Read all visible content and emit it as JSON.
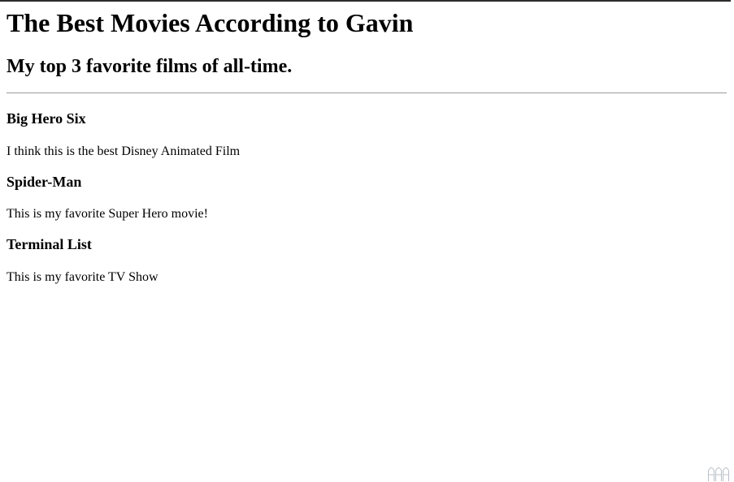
{
  "page": {
    "heading": "The Best Movies According to Gavin",
    "subheading": "My top 3 favorite films of all-time."
  },
  "movies": [
    {
      "title": "Big Hero Six",
      "description": "I think this is the best Disney Animated Film"
    },
    {
      "title": "Spider-Man",
      "description": "This is my favorite Super Hero movie!"
    },
    {
      "title": "Terminal List",
      "description": "This is my favorite TV Show"
    }
  ],
  "colors": {
    "text": "#000000",
    "rule": "#9a9a9a",
    "top_bar": "#2b2b2b",
    "logo": "#b8bfc8"
  },
  "icons": {
    "corner_logo": "watermark-logo-icon"
  }
}
